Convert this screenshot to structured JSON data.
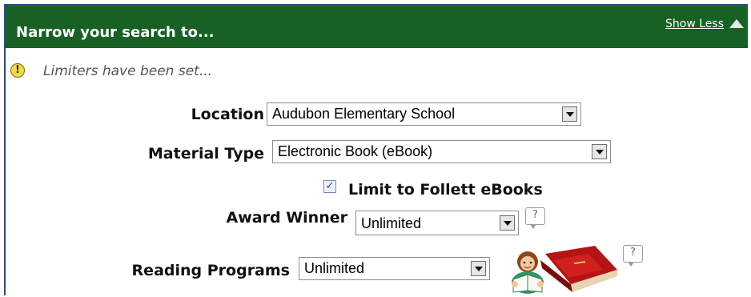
{
  "header": {
    "title": "Narrow your search to...",
    "show_less_label": "Show Less"
  },
  "notice": {
    "text": "Limiters have been set..."
  },
  "filters": {
    "location": {
      "label": "Location",
      "value": "Audubon Elementary School"
    },
    "material_type": {
      "label": "Material Type",
      "value": "Electronic Book (eBook)"
    },
    "follett_ebooks": {
      "label": "Limit to Follett eBooks",
      "checked": true
    },
    "award_winner": {
      "label": "Award Winner",
      "value": "Unlimited"
    },
    "reading_programs": {
      "label": "Reading Programs",
      "value": "Unlimited"
    }
  },
  "icons": {
    "help": "help-bubble-icon",
    "notice": "exclamation-icon",
    "show_less": "triangle-up-icon",
    "reading": "reading-child-books-icon"
  },
  "colors": {
    "header_bg": "#176125",
    "border": "#2a4f8a",
    "notice_icon": "#f2d94b"
  }
}
